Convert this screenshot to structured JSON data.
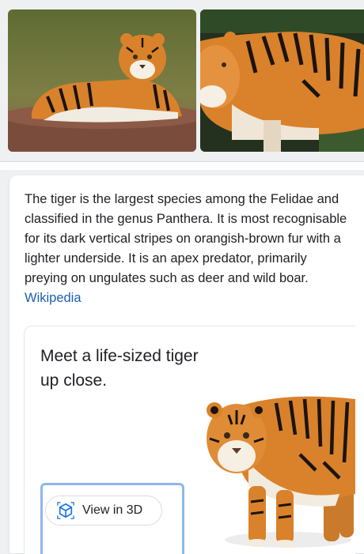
{
  "images": {
    "photo_1": {
      "alt": "tiger"
    },
    "photo_2": {
      "alt": "tiger"
    }
  },
  "knowledge_panel": {
    "description": "The tiger is the largest species among the Felidae and classified in the genus Panthera. It is most recognisable for its dark vertical stripes on orangish-brown fur with a lighter underside. It is an apex predator, primarily preying on ungulates such as deer and wild boar.",
    "source_link": "Wikipedia"
  },
  "ar_card": {
    "title": "Meet a life-sized tiger up close.",
    "view_button_label": "View in 3D",
    "view_button_icon": "cube-3d-icon"
  },
  "colors": {
    "link": "#1a5fb4",
    "accent_frame": "#8fb6ea",
    "tiger_orange": "#d9822b"
  }
}
